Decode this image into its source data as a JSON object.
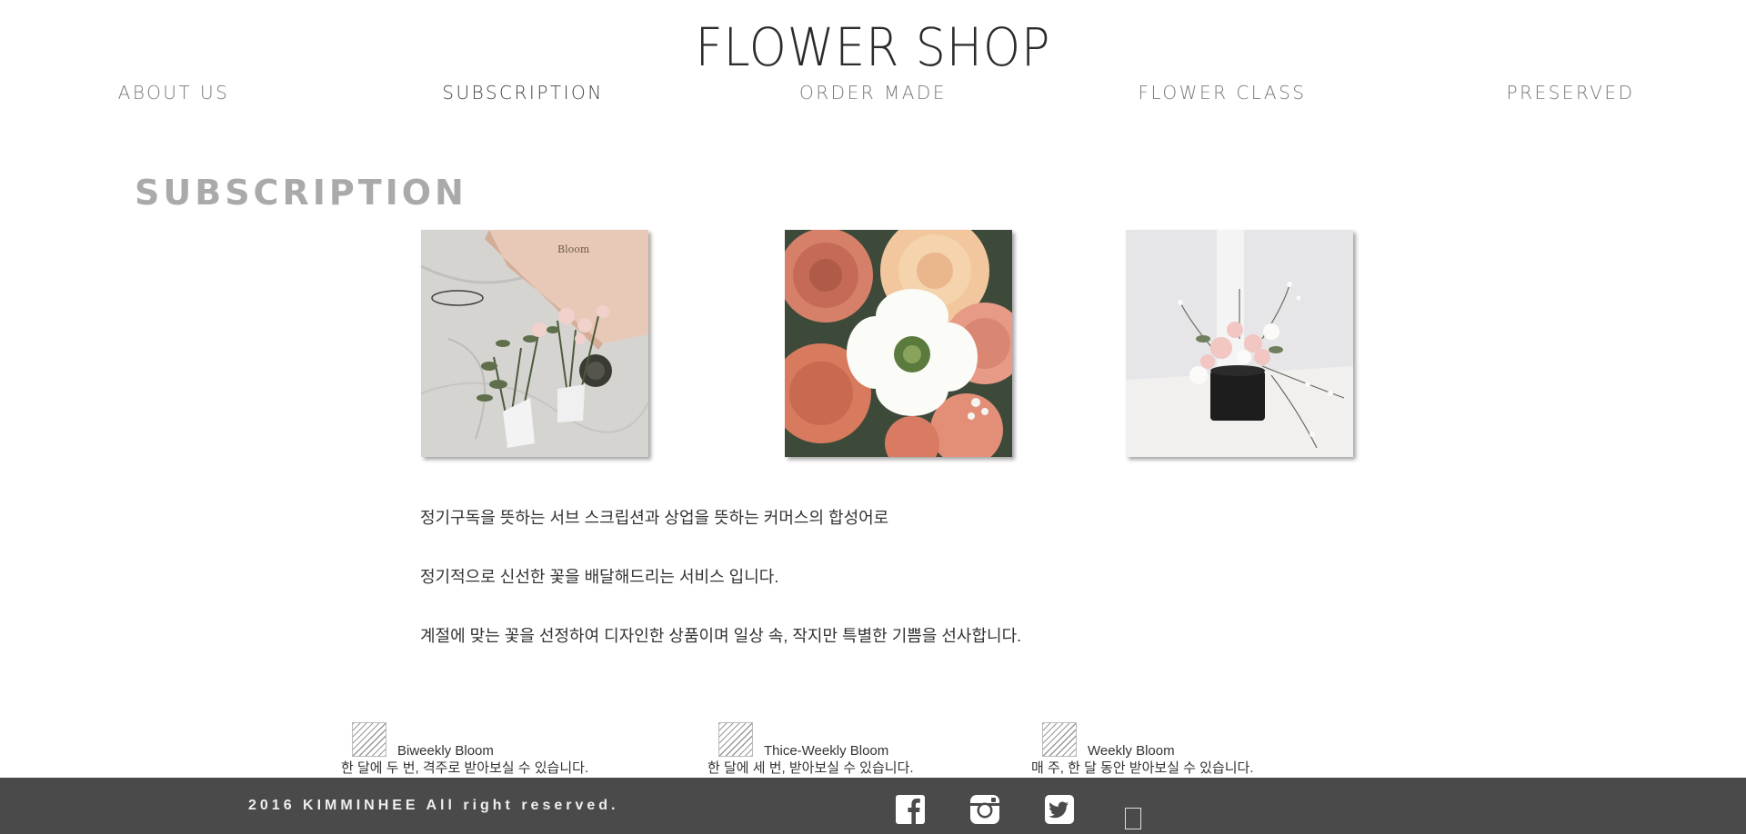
{
  "brand": {
    "logo": "FLOWER SHOP"
  },
  "nav": {
    "items": [
      {
        "label": "ABOUT US"
      },
      {
        "label": "SUBSCRIPTION"
      },
      {
        "label": "ORDER MADE"
      },
      {
        "label": "FLOWER CLASS"
      },
      {
        "label": "PRESERVED"
      }
    ],
    "active": "SUBSCRIPTION"
  },
  "section": {
    "title": "SUBSCRIPTION"
  },
  "gallery": [
    {
      "name": "bouquet-box-photo"
    },
    {
      "name": "ranunculus-closeup-photo"
    },
    {
      "name": "vase-arrangement-photo"
    }
  ],
  "description": {
    "lines": [
      "정기구독을 뜻하는 서브 스크립션과 상업을 뜻하는 커머스의 합성어로",
      "정기적으로 신선한 꽃을 배달해드리는 서비스 입니다.",
      "계절에 맞는 꽃을 선정하여 디자인한 상품이며 일상 속, 작지만 특별한 기쁨을 선사합니다."
    ]
  },
  "plans": [
    {
      "name": "Biweekly Bloom",
      "detail": "한 달에 두 번, 격주로 받아보실 수 있습니다."
    },
    {
      "name": "Thice-Weekly Bloom",
      "detail": "한 달에 세 번, 받아보실 수 있습니다."
    },
    {
      "name": "Weekly Bloom",
      "detail": "매 주, 한 달 동안 받아보실 수 있습니다."
    }
  ],
  "footer": {
    "copyright": "2016 KIMMINHEE All right reserved.",
    "social": [
      "facebook-icon",
      "instagram-icon",
      "twitter-icon"
    ],
    "background": "#4a4a4a"
  }
}
